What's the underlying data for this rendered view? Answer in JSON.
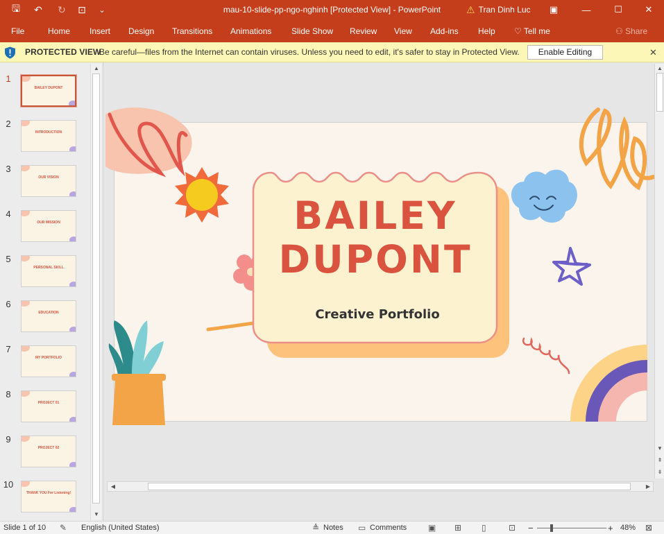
{
  "app": {
    "title": "mau-10-slide-pp-ngo-nghinh [Protected View]  -  PowerPoint",
    "user": "Tran Dinh Luc",
    "warning_glyph": "⚠"
  },
  "quick_access": {
    "save": "🖫",
    "undo": "↶",
    "redo": "↻",
    "present": "⊡",
    "more": "⌄"
  },
  "window_controls": {
    "restore_ribbon": "▣",
    "minimize": "—",
    "maximize": "☐",
    "close": "✕"
  },
  "ribbon": {
    "tabs": [
      "File",
      "Home",
      "Insert",
      "Design",
      "Transitions",
      "Animations",
      "Slide Show",
      "Review",
      "View",
      "Add-ins",
      "Help",
      "Tell me"
    ],
    "tell_me_glyph": "♡",
    "share": "Share",
    "share_glyph": "⚇"
  },
  "protected_view": {
    "label": "PROTECTED VIEW",
    "message": "Be careful—files from the Internet can contain viruses. Unless you need to edit, it's safer to stay in Protected View.",
    "button": "Enable Editing",
    "close_glyph": "✕"
  },
  "thumbnails": [
    {
      "num": "1",
      "title": "BAILEY DUPONT",
      "active": true
    },
    {
      "num": "2",
      "title": "INTRODUCTION"
    },
    {
      "num": "3",
      "title": "OUR VISION"
    },
    {
      "num": "4",
      "title": "OUR MISSION"
    },
    {
      "num": "5",
      "title": "PERSONAL SKILL"
    },
    {
      "num": "6",
      "title": "EDUCATION"
    },
    {
      "num": "7",
      "title": "MY PORTFOLIO"
    },
    {
      "num": "8",
      "title": "PROJECT 01"
    },
    {
      "num": "9",
      "title": "PROJECT 02"
    },
    {
      "num": "10",
      "title": "THANK YOU For Listening!"
    }
  ],
  "scroll_glyphs": {
    "up": "▲",
    "down": "▼",
    "left": "◀",
    "right": "▶",
    "page_up": "⇞",
    "page_down": "⇟"
  },
  "slide": {
    "name": "BAILEY DUPONT",
    "subtitle": "Creative Portfolio"
  },
  "status": {
    "slide_info": "Slide 1 of 10",
    "language": "English (United States)",
    "notes": "Notes",
    "comments": "Comments",
    "zoom_out": "−",
    "zoom_in": "+",
    "zoom_percent": 48,
    "zoom": "48%",
    "icons": {
      "spell": "✎",
      "notes": "≜",
      "comments": "▭",
      "normal": "▣",
      "sorter": "⊞",
      "reading": "▯",
      "slideshow": "⊡",
      "fit": "⊠"
    }
  },
  "colors": {
    "accent": "#c43e1c",
    "slide_bg": "#fbf4ec",
    "title_red": "#d9533e",
    "card_fill": "#fdf2d0",
    "card_shadow": "#fdc37d"
  }
}
